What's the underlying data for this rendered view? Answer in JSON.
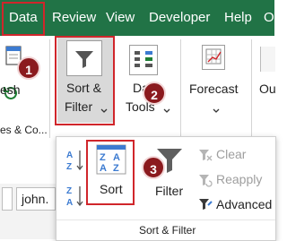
{
  "tabs": {
    "data": "Data",
    "review": "Review",
    "view": "View",
    "developer": "Developer",
    "help": "Help",
    "overflow": "O"
  },
  "ribbon": {
    "refresh_label": "esh",
    "queries_group_label": "es & Co...",
    "sort_filter_line1": "Sort &",
    "sort_filter_line2": "Filter",
    "data_tools_line1": "Data",
    "data_tools_line2": "Tools",
    "forecast_label": "Forecast",
    "outline_label": "Ou"
  },
  "badges": {
    "b1": "1",
    "b2": "2",
    "b3": "3"
  },
  "popup": {
    "sort_label": "Sort",
    "filter_label": "Filter",
    "clear_label": "Clear",
    "reapply_label": "Reapply",
    "advanced_label": "Advanced",
    "group_label": "Sort & Filter"
  },
  "sheet": {
    "cell_value": "john."
  },
  "colors": {
    "accent": "#217346",
    "highlight": "#d0262b",
    "badge": "#8b1a1e"
  }
}
